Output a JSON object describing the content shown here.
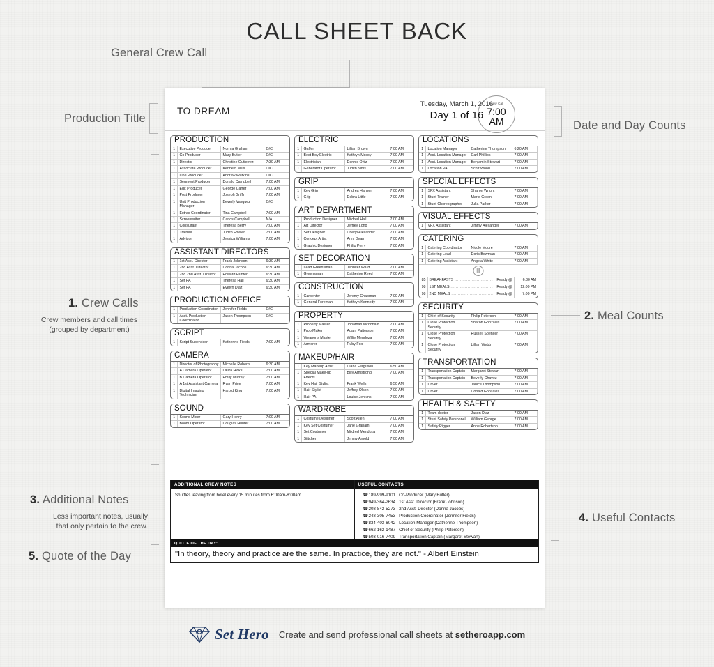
{
  "page": {
    "title": "CALL SHEET BACK"
  },
  "annotations": {
    "general_crew_call": "General Crew Call",
    "production_title": "Production Title",
    "date_and_day_counts": "Date and Day Counts",
    "crew_calls_num": "1.",
    "crew_calls": "Crew Calls",
    "crew_calls_sub_1": "Crew members and call times",
    "crew_calls_sub_2": "(grouped by department)",
    "meal_counts_num": "2.",
    "meal_counts": "Meal Counts",
    "additional_notes_num": "3.",
    "additional_notes": "Additional Notes",
    "additional_notes_sub_1": "Less important notes, usually",
    "additional_notes_sub_2": "that only pertain to the crew.",
    "useful_contacts_num": "4.",
    "useful_contacts": "Useful Contacts",
    "quote_num": "5.",
    "quote": "Quote of the Day"
  },
  "header": {
    "production_title": "TO DREAM",
    "crew_call_label": "Crew Call",
    "crew_call_time": "7:00",
    "crew_call_meridiem": "AM",
    "date": "Tuesday, March 1, 2016",
    "day_count": "Day 1 of 16"
  },
  "departments": {
    "col1": [
      {
        "name": "PRODUCTION",
        "rows": [
          [
            "1",
            "Executive Producer",
            "Norma Graham",
            "O/C"
          ],
          [
            "1",
            "Co-Producer",
            "Mary Butler",
            "O/C"
          ],
          [
            "1",
            "Director",
            "Christine Gutierrez",
            "7:30 AM"
          ],
          [
            "1",
            "Associate Producer",
            "Kenneth Mills",
            "O/C"
          ],
          [
            "1",
            "Line Producer",
            "Andrew Watkins",
            "O/C"
          ],
          [
            "1",
            "Segment Producer",
            "Donald Campbell",
            "7:00 AM"
          ],
          [
            "1",
            "Edit Producer",
            "George Carter",
            "7:00 AM"
          ],
          [
            "1",
            "Post Producer",
            "Joseph Griffin",
            "7:00 AM"
          ],
          [
            "1",
            "Unit Production Manager",
            "Beverly Vasquez",
            "O/C"
          ],
          [
            "1",
            "Extras Coordinator",
            "Tina Campbell",
            "7:00 AM"
          ],
          [
            "1",
            "Screenwriter",
            "Carlos Campbell",
            "N/A"
          ],
          [
            "1",
            "Consultant",
            "Theresa Berry",
            "7:00 AM"
          ],
          [
            "1",
            "Trainee",
            "Judith Fowler",
            "7:00 AM"
          ],
          [
            "1",
            "Advisor",
            "Jessica Williams",
            "7:00 AM"
          ]
        ]
      },
      {
        "name": "ASSISTANT DIRECTORS",
        "rows": [
          [
            "1",
            "1st Asst. Director",
            "Frank Johnson",
            "6:30 AM"
          ],
          [
            "1",
            "2nd Asst. Director",
            "Donna Jacobs",
            "6:30 AM"
          ],
          [
            "1",
            "2nd 2nd Asst. Director",
            "Edward Hunter",
            "6:30 AM"
          ],
          [
            "1",
            "Set PA",
            "Theresa Hall",
            "6:30 AM"
          ],
          [
            "1",
            "Set PA",
            "Evelyn Diaz",
            "6:30 AM"
          ]
        ]
      },
      {
        "name": "PRODUCTION OFFICE",
        "rows": [
          [
            "1",
            "Production Coordinator",
            "Jennifer Fields",
            "O/C"
          ],
          [
            "1",
            "Asst. Production Coordinator",
            "Jason Thompson",
            "O/C"
          ]
        ]
      },
      {
        "name": "SCRIPT",
        "rows": [
          [
            "1",
            "Script Supervisor",
            "Katherine Fields",
            "7:00 AM"
          ]
        ]
      },
      {
        "name": "CAMERA",
        "rows": [
          [
            "1",
            "Director of Photography",
            "Michelle Roberts",
            "6:30 AM"
          ],
          [
            "1",
            "A Camera Operator",
            "Laura Hicks",
            "7:00 AM"
          ],
          [
            "1",
            "B Camera Operator",
            "Emily Murray",
            "7:00 AM"
          ],
          [
            "1",
            "A 1st Assistant Camera",
            "Ryan Price",
            "7:00 AM"
          ],
          [
            "1",
            "Digital Imaging Technician",
            "Harold King",
            "7:00 AM"
          ]
        ]
      },
      {
        "name": "SOUND",
        "rows": [
          [
            "1",
            "Sound Mixer",
            "Gary Henry",
            "7:00 AM"
          ],
          [
            "1",
            "Boom Operator",
            "Douglas Hunter",
            "7:00 AM"
          ]
        ]
      }
    ],
    "col2": [
      {
        "name": "ELECTRIC",
        "rows": [
          [
            "1",
            "Gaffer",
            "Lillian Brown",
            "7:00 AM"
          ],
          [
            "1",
            "Best Boy Electric",
            "Kathryn Mccoy",
            "7:00 AM"
          ],
          [
            "1",
            "Electrician",
            "Dennis Ortiz",
            "7:00 AM"
          ],
          [
            "1",
            "Generator Operator",
            "Judith Sims",
            "7:00 AM"
          ]
        ]
      },
      {
        "name": "GRIP",
        "rows": [
          [
            "1",
            "Key Grip",
            "Andrea Hansen",
            "7:00 AM"
          ],
          [
            "1",
            "Grip",
            "Debra Little",
            "7:00 AM"
          ]
        ]
      },
      {
        "name": "ART DEPARTMENT",
        "rows": [
          [
            "1",
            "Production Designer",
            "Mildred Hall",
            "7:00 AM"
          ],
          [
            "1",
            "Art Director",
            "Jeffrey Long",
            "7:00 AM"
          ],
          [
            "1",
            "Set Designer",
            "Cheryl Alexander",
            "7:00 AM"
          ],
          [
            "1",
            "Concept Artist",
            "Amy Dean",
            "7:00 AM"
          ],
          [
            "1",
            "Graphic Designer",
            "Philip Perry",
            "7:00 AM"
          ]
        ]
      },
      {
        "name": "SET DECORATION",
        "rows": [
          [
            "1",
            "Lead Greensman",
            "Jennifer Ward",
            "7:00 AM"
          ],
          [
            "1",
            "Greensman",
            "Catherine Reed",
            "7:00 AM"
          ]
        ]
      },
      {
        "name": "CONSTRUCTION",
        "rows": [
          [
            "1",
            "Carpenter",
            "Jeremy Chapman",
            "7:00 AM"
          ],
          [
            "1",
            "General Foreman",
            "Kathryn Kennedy",
            "7:00 AM"
          ]
        ]
      },
      {
        "name": "PROPERTY",
        "rows": [
          [
            "1",
            "Property Master",
            "Jonathan Mcdonald",
            "7:00 AM"
          ],
          [
            "1",
            "Prop Maker",
            "Adam Patterson",
            "7:00 AM"
          ],
          [
            "1",
            "Weapons Master",
            "Willie Mendoza",
            "7:00 AM"
          ],
          [
            "1",
            "Armorer",
            "Ruby Fox",
            "7:00 AM"
          ]
        ]
      },
      {
        "name": "MAKEUP/HAIR",
        "rows": [
          [
            "1",
            "Key Makeup Artist",
            "Diana Ferguson",
            "6:50 AM"
          ],
          [
            "1",
            "Special Make-up Effects",
            "Billy Armstrong",
            "7:00 AM"
          ],
          [
            "1",
            "Key Hair Stylist",
            "Frank Wells",
            "6:50 AM"
          ],
          [
            "1",
            "Hair Stylist",
            "Jeffrey Olson",
            "7:00 AM"
          ],
          [
            "1",
            "Hair PA",
            "Louise Jenkins",
            "7:00 AM"
          ]
        ]
      },
      {
        "name": "WARDROBE",
        "rows": [
          [
            "1",
            "Costume Designer",
            "Scott Allen",
            "7:00 AM"
          ],
          [
            "1",
            "Key Set Costumer",
            "Jane Graham",
            "7:00 AM"
          ],
          [
            "1",
            "Set Costumer",
            "Mildred Mendoza",
            "7:00 AM"
          ],
          [
            "1",
            "Stitcher",
            "Jimmy Arnold",
            "7:00 AM"
          ]
        ]
      }
    ],
    "col3": [
      {
        "name": "LOCATIONS",
        "rows": [
          [
            "1",
            "Location Manager",
            "Catherine Thompson",
            "6:20 AM"
          ],
          [
            "1",
            "Asst. Location Manager",
            "Carl Phillips",
            "7:00 AM"
          ],
          [
            "1",
            "Asst. Location Manager",
            "Benjamin Stewart",
            "7:00 AM"
          ],
          [
            "1",
            "Location PA",
            "Scott Wood",
            "7:00 AM"
          ]
        ]
      },
      {
        "name": "SPECIAL EFFECTS",
        "rows": [
          [
            "1",
            "SFX Assistant",
            "Sharon Wright",
            "7:00 AM"
          ],
          [
            "1",
            "Stunt Trainer",
            "Marie Green",
            "7:00 AM"
          ],
          [
            "1",
            "Stunt Choreographer",
            "Julia Parker",
            "7:00 AM"
          ]
        ]
      },
      {
        "name": "VISUAL EFFECTS",
        "rows": [
          [
            "1",
            "VFX Assistant",
            "Jimmy Alexander",
            "7:00 AM"
          ]
        ]
      },
      {
        "name": "SECURITY",
        "rows": [
          [
            "1",
            "Chief of Security",
            "Philip Peterson",
            "7:00 AM"
          ],
          [
            "1",
            "Close Protection Security",
            "Sharon Gonzales",
            "7:00 AM"
          ],
          [
            "1",
            "Close Protection Security",
            "Russell Spencer",
            "7:00 AM"
          ],
          [
            "1",
            "Close Protection Security",
            "Lillian Webb",
            "7:00 AM"
          ]
        ]
      },
      {
        "name": "TRANSPORTATION",
        "rows": [
          [
            "1",
            "Transportation Captain",
            "Margaret Stewart",
            "7:00 AM"
          ],
          [
            "1",
            "Transportation Captain",
            "Beverly Chavez",
            "7:00 AM"
          ],
          [
            "1",
            "Driver",
            "Janice Thompson",
            "7:00 AM"
          ],
          [
            "1",
            "Driver",
            "Donald Gonzales",
            "7:00 AM"
          ]
        ]
      },
      {
        "name": "HEALTH & SAFETY",
        "rows": [
          [
            "1",
            "Team doctor",
            "Jason Diaz",
            "7:00 AM"
          ],
          [
            "1",
            "Stunt Safety Personnel",
            "William George",
            "7:00 AM"
          ],
          [
            "1",
            "Safety Rigger",
            "Anne Robertson",
            "7:00 AM"
          ]
        ]
      }
    ]
  },
  "catering": {
    "name": "CATERING",
    "rows": [
      [
        "1",
        "Catering Coordinator",
        "Nicole Moore",
        "7:00 AM"
      ],
      [
        "1",
        "Catering Lead",
        "Doris Bowman",
        "7:00 AM"
      ],
      [
        "1",
        "Catering Assistant",
        "Angela White",
        "7:00 AM"
      ]
    ],
    "icon": "utensils-icon",
    "meals": [
      {
        "count": "85",
        "label": "BREAKFASTS",
        "ready": "Ready @",
        "time": "6:30 AM"
      },
      {
        "count": "98",
        "label": "1ST MEALS",
        "ready": "Ready @",
        "time": "12:00 PM"
      },
      {
        "count": "98",
        "label": "2ND MEALS",
        "ready": "Ready @",
        "time": "7:00 PM"
      }
    ]
  },
  "notes": {
    "crew_notes_header": "ADDITIONAL CREW NOTES",
    "crew_notes_body": "Shuttles leaving from hotel every 15 minutes from 6:00am-8:00am",
    "contacts_header": "USEFUL CONTACTS",
    "contacts": [
      {
        "phone": "189-999-9101",
        "role": "Co-Producer (Mary Butler)"
      },
      {
        "phone": "949-364-2634",
        "role": "1st Asst. Director (Frank Johnson)"
      },
      {
        "phone": "208-842-5273",
        "role": "2nd Asst. Director (Donna Jacobs)"
      },
      {
        "phone": "248-305-7453",
        "role": "Production Coordinator (Jennifer Fields)"
      },
      {
        "phone": "834-403-6042",
        "role": "Location Manager (Catherine Thompson)"
      },
      {
        "phone": "662-162-1487",
        "role": "Chief of Security (Philip Peterson)"
      },
      {
        "phone": "503-016-7409",
        "role": "Transportation Captain (Margaret Stewart)"
      }
    ],
    "quote_header": "QUOTE OF THE DAY:",
    "quote_body": "\"In theory, theory and practice are the same. In practice, they are not.\" - Albert Einstein"
  },
  "footer": {
    "brand": "Set Hero",
    "tagline_pre": "Create and send professional call sheets at ",
    "tagline_domain": "setheroapp.com",
    "brand_color": "#1f3864"
  }
}
